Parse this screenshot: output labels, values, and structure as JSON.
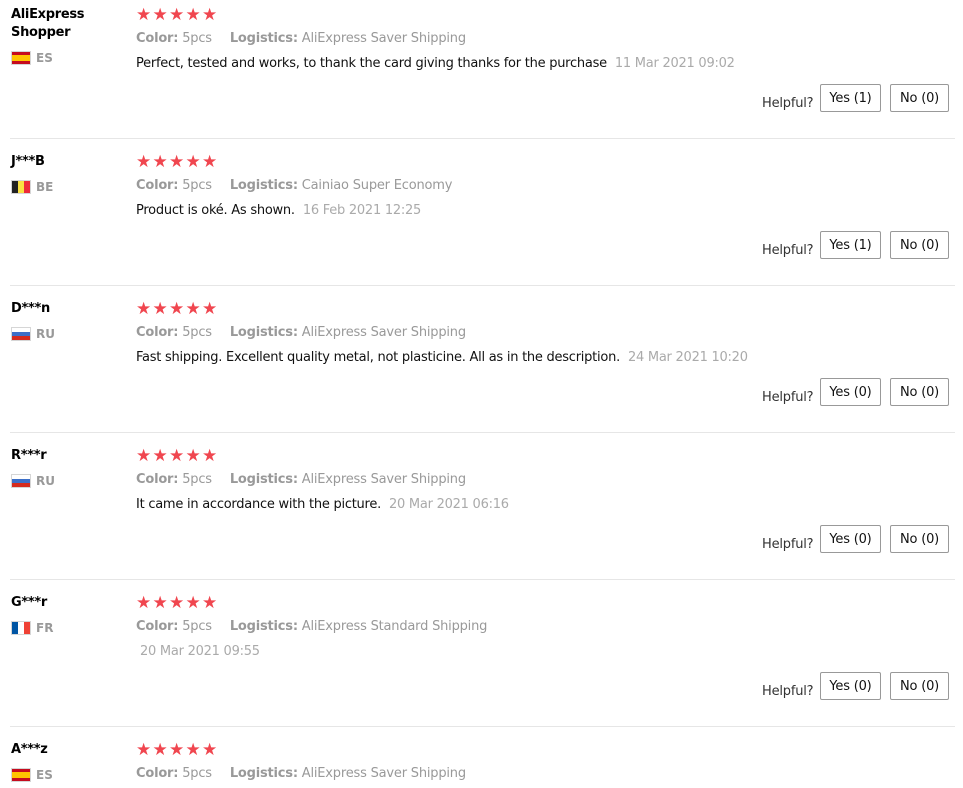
{
  "helpful_label": "Helpful?",
  "reviews": [
    {
      "user": "AliExpress Shopper",
      "country": "ES",
      "flag": "spain-flag",
      "rating": 5,
      "color_label": "Color:",
      "color_value": "5pcs",
      "logistics_label": "Logistics:",
      "logistics_value": "AliExpress Saver Shipping",
      "text": "Perfect, tested and works, to thank the card giving thanks for the purchase",
      "date": "11 Mar 2021 09:02",
      "yes": "Yes (1)",
      "no": "No (0)"
    },
    {
      "user": "J***B",
      "country": "BE",
      "flag": "belgium-flag",
      "rating": 5,
      "color_label": "Color:",
      "color_value": "5pcs",
      "logistics_label": "Logistics:",
      "logistics_value": "Cainiao Super Economy",
      "text": "Product is oké. As shown.",
      "date": "16 Feb 2021 12:25",
      "yes": "Yes (1)",
      "no": "No (0)"
    },
    {
      "user": "D***n",
      "country": "RU",
      "flag": "russia-flag",
      "rating": 5,
      "color_label": "Color:",
      "color_value": "5pcs",
      "logistics_label": "Logistics:",
      "logistics_value": "AliExpress Saver Shipping",
      "text": "Fast shipping. Excellent quality metal, not plasticine. All as in the description.",
      "date": "24 Mar 2021 10:20",
      "yes": "Yes (0)",
      "no": "No (0)"
    },
    {
      "user": "R***r",
      "country": "RU",
      "flag": "russia-flag",
      "rating": 5,
      "color_label": "Color:",
      "color_value": "5pcs",
      "logistics_label": "Logistics:",
      "logistics_value": "AliExpress Saver Shipping",
      "text": "It came in accordance with the picture.",
      "date": "20 Mar 2021 06:16",
      "yes": "Yes (0)",
      "no": "No (0)"
    },
    {
      "user": "G***r",
      "country": "FR",
      "flag": "france-flag",
      "rating": 5,
      "color_label": "Color:",
      "color_value": "5pcs",
      "logistics_label": "Logistics:",
      "logistics_value": "AliExpress Standard Shipping",
      "text": "",
      "date": "20 Mar 2021 09:55",
      "yes": "Yes (0)",
      "no": "No (0)"
    },
    {
      "user": "A***z",
      "country": "ES",
      "flag": "spain-flag",
      "rating": 5,
      "color_label": "Color:",
      "color_value": "5pcs",
      "logistics_label": "Logistics:",
      "logistics_value": "AliExpress Saver Shipping"
    }
  ],
  "colors": {
    "star": "#f0464f",
    "muted_text": "#999999",
    "divider": "#e6e6e6"
  }
}
